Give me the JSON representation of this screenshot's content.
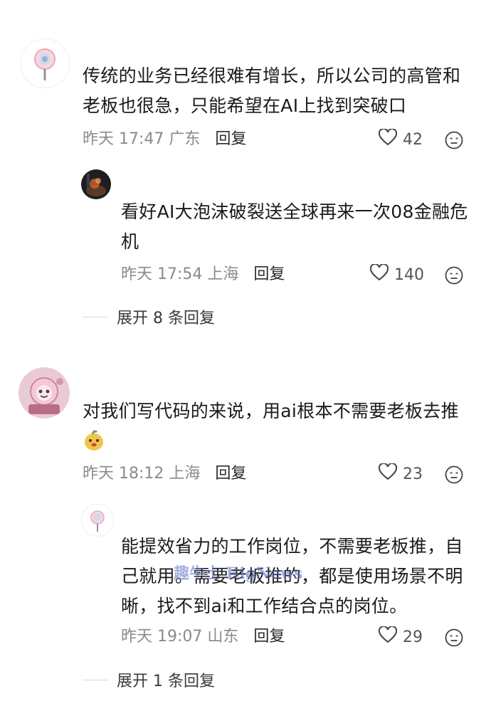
{
  "comments": [
    {
      "text": "传统的业务已经很难有增长，所以公司的高管和老板也很急，只能希望在AI上找到突破口",
      "time": "昨天 17:47 广东",
      "reply_label": "回复",
      "likes": "42",
      "replies": [
        {
          "text": "看好AI大泡沫破裂送全球再来一次08金融危机",
          "time": "昨天 17:54 上海",
          "reply_label": "回复",
          "likes": "140"
        }
      ],
      "expand_label": "展开 8 条回复"
    },
    {
      "text": "对我们写代码的来说，用ai根本不需要老板去推",
      "time": "昨天 18:12 上海",
      "reply_label": "回复",
      "likes": "23",
      "replies": [
        {
          "text": "能提效省力的工作岗位，不需要老板推，自己就用。需要老板推的，都是使用场景不明晰，找不到ai和工作结合点的岗位。",
          "time": "昨天 19:07 山东",
          "reply_label": "回复",
          "likes": "29"
        }
      ],
      "expand_label": "展开 1 条回复"
    }
  ],
  "watermark": "趣牛士 BigNews",
  "icons": {
    "like": "heart-outline-icon",
    "emoji": "emoji-reaction-icon"
  }
}
